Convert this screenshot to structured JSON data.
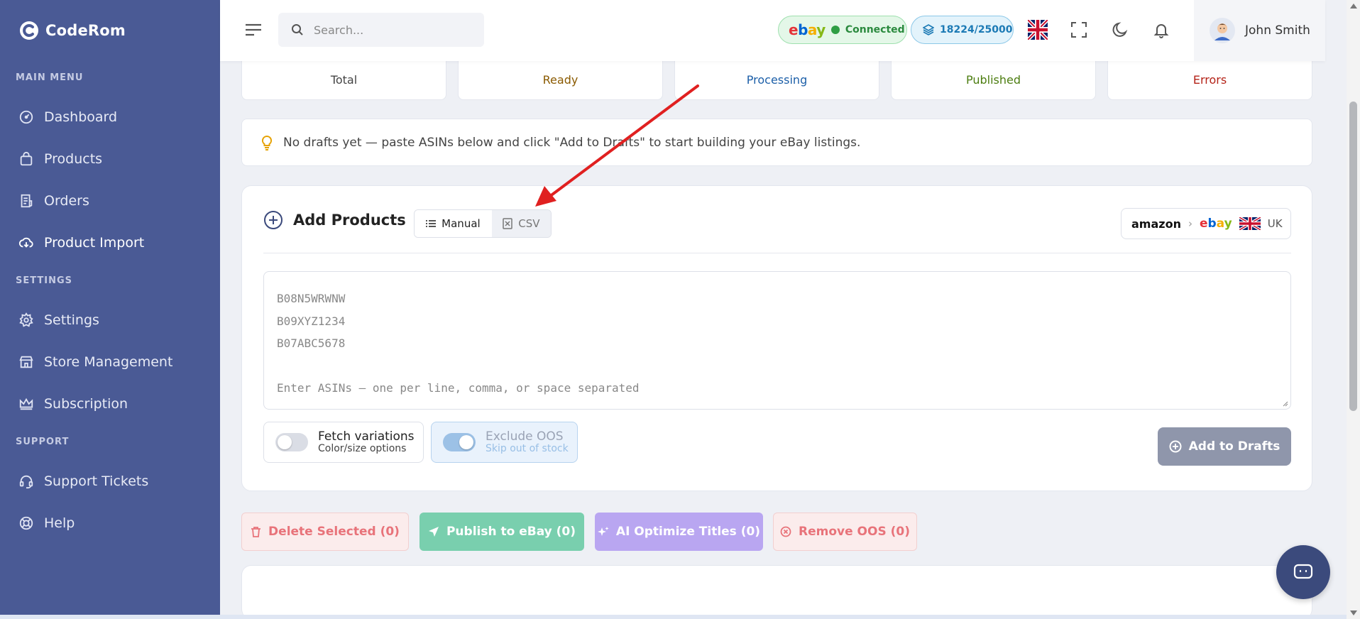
{
  "sidebar": {
    "brand": "CodeRom",
    "sections": {
      "main": "MAIN MENU",
      "settings": "SETTINGS",
      "support": "SUPPORT"
    },
    "items": [
      {
        "label": "Dashboard",
        "icon": "dashboard-icon"
      },
      {
        "label": "Products",
        "icon": "bag-icon"
      },
      {
        "label": "Orders",
        "icon": "receipt-icon"
      },
      {
        "label": "Product Import",
        "icon": "cloud-download-icon",
        "active": true
      },
      {
        "label": "Settings",
        "icon": "gear-icon"
      },
      {
        "label": "Store Management",
        "icon": "store-icon"
      },
      {
        "label": "Subscription",
        "icon": "crown-icon"
      },
      {
        "label": "Support Tickets",
        "icon": "headset-icon"
      },
      {
        "label": "Help",
        "icon": "lifebuoy-icon"
      }
    ]
  },
  "topbar": {
    "search_placeholder": "Search...",
    "ebay_logo": "ebay",
    "ebay_status": "Connected",
    "quota": "18224/25000",
    "user_name": "John Smith"
  },
  "stats": [
    "Total",
    "Ready",
    "Processing",
    "Published",
    "Errors"
  ],
  "notice": "No drafts yet — paste ASINs below and click \"Add to Drafts\" to start building your eBay listings.",
  "add_products": {
    "title": "Add Products",
    "mode_manual": "Manual",
    "mode_csv": "CSV",
    "market_from": "amazon",
    "market_to": "ebay",
    "market_region": "UK",
    "asin_lines": [
      "B08N5WRWNW",
      "B09XYZ1234",
      "B07ABC5678",
      "",
      "Enter ASINs — one per line, comma, or space separated"
    ],
    "fetch_variations": {
      "label": "Fetch variations",
      "sub": "Color/size options",
      "on": false
    },
    "exclude_oos": {
      "label": "Exclude OOS",
      "sub": "Skip out of stock",
      "on": true
    },
    "add_button": "Add to Drafts"
  },
  "actions": {
    "delete": "Delete Selected (0)",
    "publish": "Publish to eBay (0)",
    "optimize": "AI Optimize Titles (0)",
    "remove_oos": "Remove OOS (0)"
  },
  "colors": {
    "sidebar": "#4a5a95",
    "publish": "#79cfae",
    "optimize": "#b9a6f1",
    "annotation_arrow": "#e02020"
  }
}
